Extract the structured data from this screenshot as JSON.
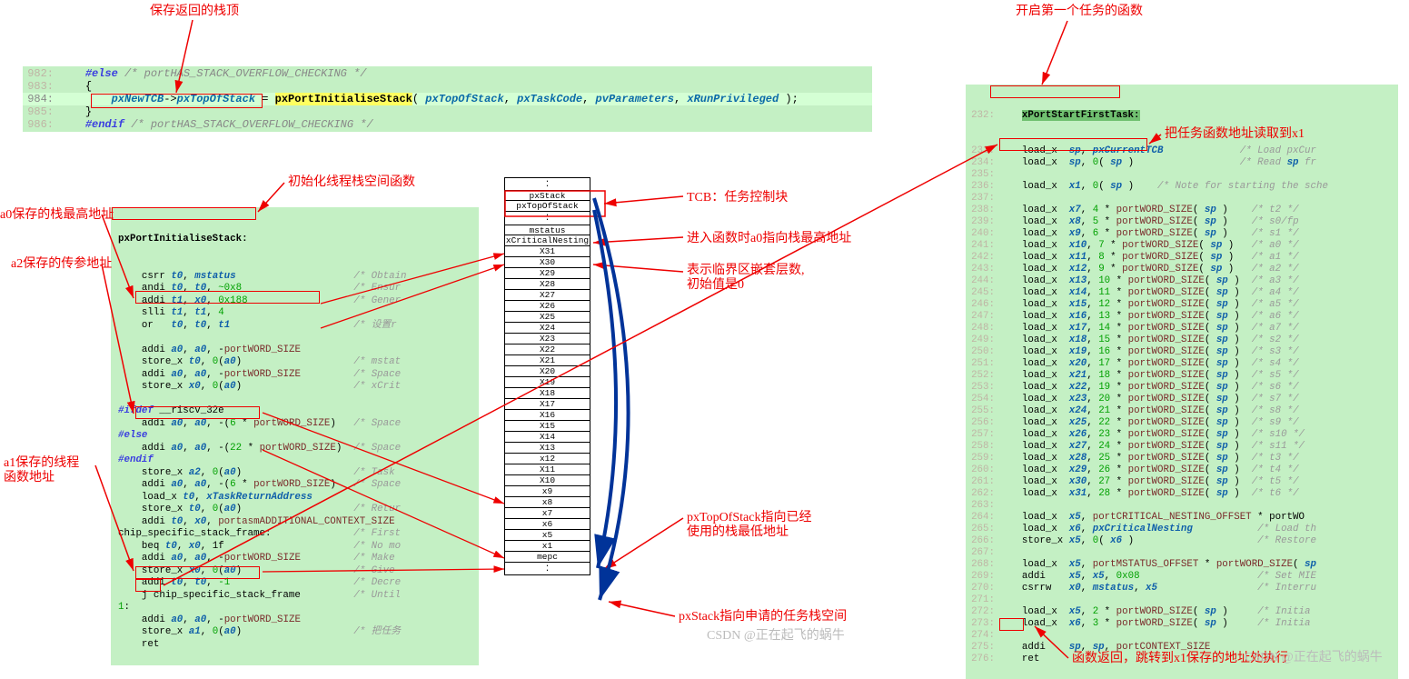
{
  "annotations": {
    "top": "保存返回的栈顶",
    "right_top": "开启第一个任务的函数",
    "init_fn": "初始化线程栈空间函数",
    "a0_high": "a0保存的栈最高地址",
    "a2_addr": "a2保存的传参地址",
    "a1_fn": "a1保存的线程\n函数地址",
    "tcb_label": "TCB：任务控制块",
    "enter_fn": "进入函数时a0指向栈最高地址",
    "critical": "表示临界区嵌套层数,\n初始值是0",
    "px_top_used": "pxTopOfStack指向已经\n使用的栈最低地址",
    "px_stack": "pxStack指向申请的任务栈空间",
    "load_x1": "把任务函数地址读取到x1",
    "ret": "函数返回，跳转到x1保存的地址处执行",
    "params": {
      "a0": "a0",
      "a1": "a1",
      "a2": "a2",
      "a3": "a3"
    }
  },
  "top_code": {
    "l982": {
      "ln": "982:",
      "pre": "#else",
      "cmt": "/* portHAS_STACK_OVERFLOW_CHECKING */"
    },
    "l983": {
      "ln": "983:",
      "txt": "{"
    },
    "l984": {
      "ln": "984:",
      "lhs": "pxNewTCB",
      "arrow": "->",
      "field": "pxTopOfStack",
      "eq": " = ",
      "fn": "pxPortInitialiseStack",
      "open": "( ",
      "p1": "pxTopOfStack",
      "p2": "pxTaskCode",
      "p3": "pvParameters",
      "p4": "xRunPrivileged",
      "close": " );"
    },
    "l985": {
      "ln": "985:",
      "txt": "}"
    },
    "l986": {
      "ln": "986:",
      "pre": "#endif",
      "cmt": "/* portHAS_STACK_OVERFLOW_CHECKING */"
    }
  },
  "left_code": {
    "label": "pxPortInitialiseStack:",
    "lines": [
      {
        "t": "    csrr t0, mstatus                    /* Obtain"
      },
      {
        "t": "    andi t0, t0, ~0x8                   /* Ensur"
      },
      {
        "t": "    addi t1, x0, 0x188                  /* Gener"
      },
      {
        "t": "    slli t1, t1, 4"
      },
      {
        "t": "    or   t0, t0, t1                     /* 设置r"
      },
      {
        "t": ""
      },
      {
        "t": "    addi a0, a0, -portWORD_SIZE"
      },
      {
        "t": "    store_x t0, 0(a0)                   /* mstat"
      },
      {
        "t": "    addi a0, a0, -portWORD_SIZE         /* Space"
      },
      {
        "t": "    store_x x0, 0(a0)                   /* xCrit"
      },
      {
        "t": ""
      },
      {
        "t": "#ifdef __riscv_32e"
      },
      {
        "t": "    addi a0, a0, -(6 * portWORD_SIZE)   /* Space"
      },
      {
        "t": "#else"
      },
      {
        "t": "    addi a0, a0, -(22 * portWORD_SIZE)  /* Space"
      },
      {
        "t": "#endif"
      },
      {
        "t": "    store_x a2, 0(a0)                   /* Task "
      },
      {
        "t": "    addi a0, a0, -(6 * portWORD_SIZE)   /* Space"
      },
      {
        "t": "    load_x t0, xTaskReturnAddress"
      },
      {
        "t": "    store_x t0, 0(a0)                   /* Retur"
      },
      {
        "t": "    addi t0, x0, portasmADDITIONAL_CONTEXT_SIZE"
      },
      {
        "t": "chip_specific_stack_frame:              /* First"
      },
      {
        "t": "    beq t0, x0, 1f                      /* No mo"
      },
      {
        "t": "    addi a0, a0, -portWORD_SIZE         /* Make "
      },
      {
        "t": "    store_x x0, 0(a0)                   /* Give "
      },
      {
        "t": "    addi t0, t0, -1                     /* Decre"
      },
      {
        "t": "    j chip_specific_stack_frame         /* Until"
      },
      {
        "t": "1:"
      },
      {
        "t": "    addi a0, a0, -portWORD_SIZE"
      },
      {
        "t": "    store_x a1, 0(a0)                   /* 把任务"
      },
      {
        "t": "    ret"
      }
    ]
  },
  "stack": {
    "top_group": [
      "pxStack",
      "pxTopOfStack"
    ],
    "cells": [
      "mstatus",
      "xCriticalNesting",
      "X31",
      "X30",
      "X29",
      "X28",
      "X27",
      "X26",
      "X25",
      "X24",
      "X23",
      "X22",
      "X21",
      "X20",
      "X19",
      "X18",
      "X17",
      "X16",
      "X15",
      "X14",
      "X13",
      "x12",
      "X11",
      "X10",
      "x9",
      "x8",
      "x7",
      "x6",
      "x5",
      "x1",
      "mepc"
    ]
  },
  "right_code": {
    "header": {
      "ln": "232:",
      "fn": "xPortStartFirstTask:"
    },
    "lines": [
      {
        "ln": "233:",
        "t": "    load_x  sp, pxCurrentTCB             /* Load pxCur"
      },
      {
        "ln": "234:",
        "t": "    load_x  sp, 0( sp )                  /* Read sp fr"
      },
      {
        "ln": "235:",
        "t": ""
      },
      {
        "ln": "236:",
        "t": "    load_x  x1, 0( sp )    /* Note for starting the sche"
      },
      {
        "ln": "237:",
        "t": ""
      },
      {
        "ln": "238:",
        "t": "    load_x  x7, 4 * portWORD_SIZE( sp )    /* t2 */"
      },
      {
        "ln": "239:",
        "t": "    load_x  x8, 5 * portWORD_SIZE( sp )    /* s0/fp "
      },
      {
        "ln": "240:",
        "t": "    load_x  x9, 6 * portWORD_SIZE( sp )    /* s1 */"
      },
      {
        "ln": "241:",
        "t": "    load_x  x10, 7 * portWORD_SIZE( sp )   /* a0 */"
      },
      {
        "ln": "242:",
        "t": "    load_x  x11, 8 * portWORD_SIZE( sp )   /* a1 */"
      },
      {
        "ln": "243:",
        "t": "    load_x  x12, 9 * portWORD_SIZE( sp )   /* a2 */"
      },
      {
        "ln": "244:",
        "t": "    load_x  x13, 10 * portWORD_SIZE( sp )  /* a3 */"
      },
      {
        "ln": "245:",
        "t": "    load_x  x14, 11 * portWORD_SIZE( sp )  /* a4 */"
      },
      {
        "ln": "246:",
        "t": "    load_x  x15, 12 * portWORD_SIZE( sp )  /* a5 */"
      },
      {
        "ln": "247:",
        "t": "    load_x  x16, 13 * portWORD_SIZE( sp )  /* a6 */"
      },
      {
        "ln": "248:",
        "t": "    load_x  x17, 14 * portWORD_SIZE( sp )  /* a7 */"
      },
      {
        "ln": "249:",
        "t": "    load_x  x18, 15 * portWORD_SIZE( sp )  /* s2 */"
      },
      {
        "ln": "250:",
        "t": "    load_x  x19, 16 * portWORD_SIZE( sp )  /* s3 */"
      },
      {
        "ln": "251:",
        "t": "    load_x  x20, 17 * portWORD_SIZE( sp )  /* s4 */"
      },
      {
        "ln": "252:",
        "t": "    load_x  x21, 18 * portWORD_SIZE( sp )  /* s5 */"
      },
      {
        "ln": "253:",
        "t": "    load_x  x22, 19 * portWORD_SIZE( sp )  /* s6 */"
      },
      {
        "ln": "254:",
        "t": "    load_x  x23, 20 * portWORD_SIZE( sp )  /* s7 */"
      },
      {
        "ln": "255:",
        "t": "    load_x  x24, 21 * portWORD_SIZE( sp )  /* s8 */"
      },
      {
        "ln": "256:",
        "t": "    load_x  x25, 22 * portWORD_SIZE( sp )  /* s9 */"
      },
      {
        "ln": "257:",
        "t": "    load_x  x26, 23 * portWORD_SIZE( sp )  /* s10 */"
      },
      {
        "ln": "258:",
        "t": "    load_x  x27, 24 * portWORD_SIZE( sp )  /* s11 */"
      },
      {
        "ln": "259:",
        "t": "    load_x  x28, 25 * portWORD_SIZE( sp )  /* t3 */"
      },
      {
        "ln": "260:",
        "t": "    load_x  x29, 26 * portWORD_SIZE( sp )  /* t4 */"
      },
      {
        "ln": "261:",
        "t": "    load_x  x30, 27 * portWORD_SIZE( sp )  /* t5 */"
      },
      {
        "ln": "262:",
        "t": "    load_x  x31, 28 * portWORD_SIZE( sp )  /* t6 */"
      },
      {
        "ln": "263:",
        "t": ""
      },
      {
        "ln": "264:",
        "t": "    load_x  x5, portCRITICAL_NESTING_OFFSET * portWO"
      },
      {
        "ln": "265:",
        "t": "    load_x  x6, pxCriticalNesting           /* Load th"
      },
      {
        "ln": "266:",
        "t": "    store_x x5, 0( x6 )                     /* Restore"
      },
      {
        "ln": "267:",
        "t": ""
      },
      {
        "ln": "268:",
        "t": "    load_x  x5, portMSTATUS_OFFSET * portWORD_SIZE( sp"
      },
      {
        "ln": "269:",
        "t": "    addi    x5, x5, 0x08                    /* Set MIE"
      },
      {
        "ln": "270:",
        "t": "    csrrw   x0, mstatus, x5                 /* Interru"
      },
      {
        "ln": "271:",
        "t": ""
      },
      {
        "ln": "272:",
        "t": "    load_x  x5, 2 * portWORD_SIZE( sp )     /* Initia"
      },
      {
        "ln": "273:",
        "t": "    load_x  x6, 3 * portWORD_SIZE( sp )     /* Initia"
      },
      {
        "ln": "274:",
        "t": ""
      },
      {
        "ln": "275:",
        "t": "    addi    sp, sp, portCONTEXT_SIZE"
      },
      {
        "ln": "276:",
        "t": "    ret"
      }
    ]
  },
  "watermark": "CSDN @正在起飞的蜗牛"
}
